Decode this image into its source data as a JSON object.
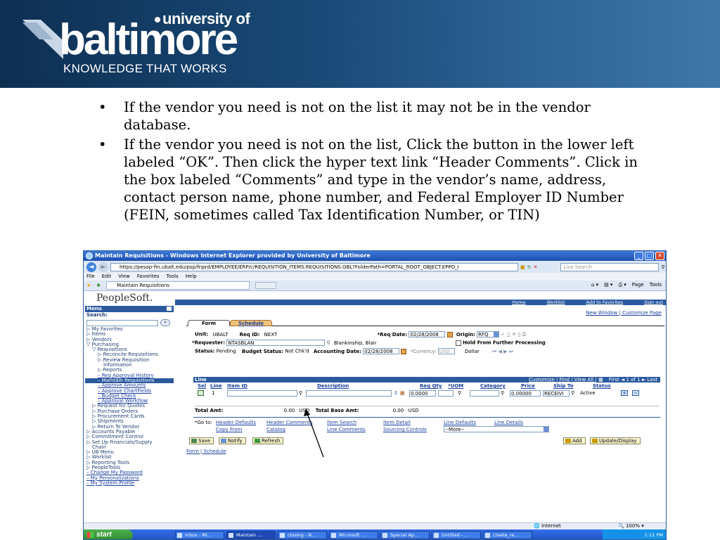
{
  "slide": {
    "logo": {
      "university_of": "university of",
      "main_word": "baltimore",
      "tagline": "KNOWLEDGE THAT WORKS"
    },
    "bullets": [
      "If the vendor you need is not on the list it may not be in the vendor database.",
      "If the vendor you need is not on the list, Click the button in the lower left labeled “OK”.  Then click the hyper text link “Header Comments”.  Click in the box labeled “Comments” and type in the vendor’s name, address, contact person name, phone number, and Federal Employer ID Number (FEIN, sometimes called Tax Identification Number, or TIN)"
    ]
  },
  "browser": {
    "title": "Maintain Requisitions - Windows Internet Explorer provided by University of Baltimore",
    "url": "https://pesop-fin.ubalt.edu/psp/fnprd/EMPLOYEE/ERP/c/REQUISITION_ITEMS.REQUISITIONS.GBL?FolderPath=PORTAL_ROOT_OBJECT.EPPO_I",
    "search_placeholder": "Live Search",
    "menus": [
      "File",
      "Edit",
      "View",
      "Favorites",
      "Tools",
      "Help"
    ],
    "tab_label": "Maintain Requisitions",
    "cmd_page": "Page",
    "cmd_tools": "Tools",
    "status_internet": "Internet",
    "zoom": "100%"
  },
  "peoplesoft": {
    "logo": "PeopleSoft.",
    "topnav": [
      "Home",
      "Worklist",
      "Add to Favorites",
      "Sign out"
    ],
    "menu": {
      "title": "Menu",
      "search_label": "Search:",
      "items": [
        {
          "label": "▷ My Favorites",
          "indent": 0,
          "style": "normal"
        },
        {
          "label": "▷ Items",
          "indent": 0,
          "style": "normal"
        },
        {
          "label": "▷ Vendors",
          "indent": 0,
          "style": "normal"
        },
        {
          "label": "▽ Purchasing",
          "indent": 0,
          "style": "normal"
        },
        {
          "label": "▽ Requisitions",
          "indent": 1,
          "style": "normal"
        },
        {
          "label": "▷ Reconcile Requisitions",
          "indent": 2,
          "style": "normal"
        },
        {
          "label": "▷ Review Requisition",
          "indent": 2,
          "style": "normal"
        },
        {
          "label": "Information",
          "indent": 3,
          "style": "normal"
        },
        {
          "label": "▷ Reports",
          "indent": 2,
          "style": "normal"
        },
        {
          "label": "– Req Approval History",
          "indent": 2,
          "style": "link"
        },
        {
          "label": "– Maintain Requisitions",
          "indent": 2,
          "style": "selected"
        },
        {
          "label": "– Approve Amounts",
          "indent": 2,
          "style": "link"
        },
        {
          "label": "– Approve ChartFields",
          "indent": 2,
          "style": "link"
        },
        {
          "label": "– Budget Check",
          "indent": 2,
          "style": "link"
        },
        {
          "label": "– Approval Workflow",
          "indent": 2,
          "style": "link"
        },
        {
          "label": "▷ Request for Quotes",
          "indent": 1,
          "style": "normal"
        },
        {
          "label": "▷ Purchase Orders",
          "indent": 1,
          "style": "normal"
        },
        {
          "label": "▷ Procurement Cards",
          "indent": 1,
          "style": "normal"
        },
        {
          "label": "▷ Shipments",
          "indent": 1,
          "style": "normal"
        },
        {
          "label": "▷ Return To Vendor",
          "indent": 1,
          "style": "normal"
        },
        {
          "label": "▷ Accounts Payable",
          "indent": 0,
          "style": "normal"
        },
        {
          "label": "▷ Commitment Control",
          "indent": 0,
          "style": "normal"
        },
        {
          "label": "▷ Set Up Financials/Supply",
          "indent": 0,
          "style": "normal"
        },
        {
          "label": "Chain",
          "indent": 1,
          "style": "normal"
        },
        {
          "label": "▷ UB Menu",
          "indent": 0,
          "style": "normal"
        },
        {
          "label": "▷ Worklist",
          "indent": 0,
          "style": "normal"
        },
        {
          "label": "▷ Reporting Tools",
          "indent": 0,
          "style": "normal"
        },
        {
          "label": "▷ PeopleTools",
          "indent": 0,
          "style": "normal"
        },
        {
          "label": "– Change My Password",
          "indent": 0,
          "style": "link"
        },
        {
          "label": "– My Personalizations",
          "indent": 0,
          "style": "link"
        },
        {
          "label": "– My System Profile",
          "indent": 0,
          "style": "link"
        }
      ]
    },
    "top_links": "New Window | Customize Page",
    "tabs": {
      "form": "Form",
      "schedule": "Schedule"
    },
    "form": {
      "unit_label": "Unit:",
      "unit_value": "UBALT",
      "reqid_label": "Req ID:",
      "reqid_value": "NEXT",
      "reqdate_label": "*Req Date:",
      "reqdate_value": "02/28/2008",
      "origin_label": "Origin:",
      "origin_value": "RFQ",
      "requester_label": "*Requester:",
      "requester_value": "NTASBLAN",
      "requester_name": "Blankinship, Blair",
      "hold_label": "Hold From Further Processing",
      "status_label": "Status:",
      "status_value": "Pending",
      "budget_label": "Budget Status:",
      "budget_value": "Not Chk'd",
      "acctdate_label": "Accounting Date:",
      "acctdate_value": "02/28/2008",
      "currency_label": "*Currency:",
      "currency_value": "USD",
      "currency_name": "Dollar"
    },
    "line_grid": {
      "title": "Line",
      "nav": "Customize | Find | View All |",
      "nav_range": "First ◄ 1 of 1 ► Last",
      "columns": [
        "Sel",
        "Line",
        "Item ID",
        "Description",
        "Req Qty",
        "*UOM",
        "Category",
        "Price",
        "Ship To",
        "Status"
      ],
      "row": {
        "line": "1",
        "qty": "0.0000",
        "price": "0.00000",
        "ship_to": "RECEIVI",
        "status": "Active"
      }
    },
    "totals": {
      "total_label": "Total Amt:",
      "total_value": "0.00",
      "total_currency": "USD",
      "base_label": "Total Base Amt:",
      "base_value": "0.00",
      "base_currency": "USD"
    },
    "goto": {
      "label": "*Go to:",
      "links_row1": [
        "Header Defaults",
        "Header Comments",
        "Item Search",
        "Item Detail",
        "Line Defaults",
        "Line Details"
      ],
      "links_row2": [
        "Copy From",
        "Catalog",
        "Line Comments",
        "Sourcing Controls"
      ],
      "more_value": "--More--"
    },
    "buttons": {
      "save": "Save",
      "notify": "Notify",
      "refresh": "Refresh",
      "add": "Add",
      "update": "Update/Display"
    },
    "bottom_links": "Form | Schedule"
  },
  "taskbar": {
    "start": "start",
    "tasks": [
      "Inbox - Mi...",
      "Maintain ...",
      "closing - N...",
      "Microsoft ...",
      "Special Ap...",
      "Untitled - ...",
      "create_re..."
    ],
    "clock": "1:11 PM"
  },
  "colors": {
    "header_dark": "#0e2f52",
    "peoplesoft_blue": "#2b5a9f",
    "link_blue": "#1b3fa0"
  }
}
